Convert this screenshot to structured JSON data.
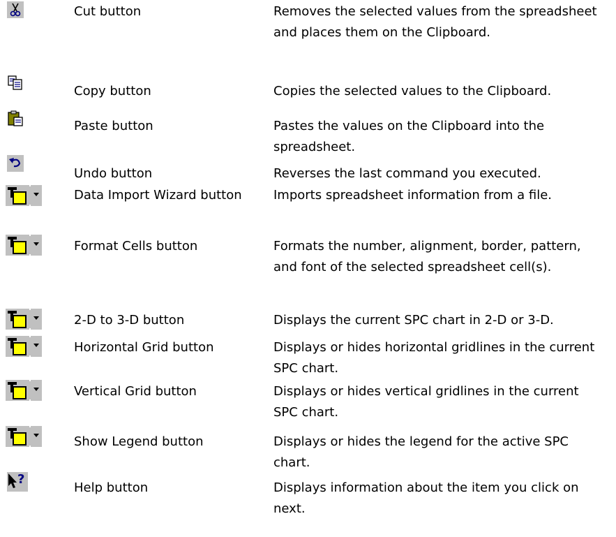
{
  "rows": [
    {
      "icon": "scissors-icon",
      "name": "Cut button",
      "description": "Removes the selected values from the spreadsheet and places them on the Clipboard."
    },
    {
      "icon": "copy-icon",
      "name": "Copy button",
      "description": "Copies the selected values to the Clipboard."
    },
    {
      "icon": "paste-icon",
      "name": "Paste button",
      "description": "Pastes the values on the Clipboard into the spreadsheet."
    },
    {
      "icon": "undo-icon",
      "name": "Undo button",
      "description": "Reverses the last command you executed."
    },
    {
      "icon": "color-dropdown-icon",
      "name": "Data Import Wizard button",
      "description": "Imports spreadsheet information from a file."
    },
    {
      "icon": "color-dropdown-icon",
      "name": "Format Cells button",
      "description": "Formats the number, alignment, border, pattern, and font of the selected spreadsheet cell(s)."
    },
    {
      "icon": "color-dropdown-icon",
      "name": "2-D to 3-D button",
      "description": "Displays the current SPC chart in 2-D or 3-D."
    },
    {
      "icon": "color-dropdown-icon",
      "name": "Horizontal Grid button",
      "description": "Displays or hides horizontal gridlines in the current SPC chart."
    },
    {
      "icon": "color-dropdown-icon",
      "name": "Vertical Grid button",
      "description": "Displays or hides vertical gridlines in the current SPC chart."
    },
    {
      "icon": "color-dropdown-icon",
      "name": "Show Legend button",
      "description": "Displays or hides the legend for the active SPC chart."
    },
    {
      "icon": "help-pointer-icon",
      "name": "Help button",
      "description": "Displays information about the item you click on next."
    }
  ],
  "colors": {
    "text": "#000000",
    "icon_face": "#c0c0c0",
    "icon_yellow": "#ffff00",
    "icon_blue": "#000080",
    "background": "#ffffff"
  }
}
